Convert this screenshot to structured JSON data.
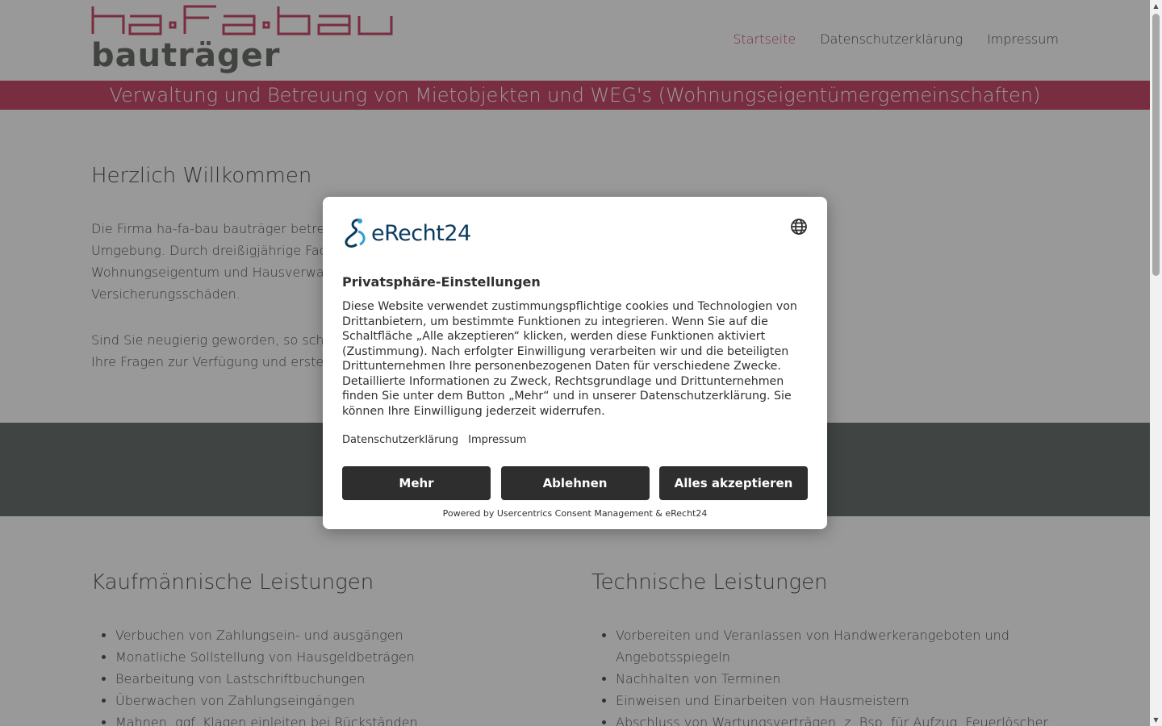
{
  "header": {
    "logo_top_text": "ha-fa-bau",
    "logo_bottom_text": "bauträger",
    "nav": [
      {
        "label": "Startseite",
        "active": true
      },
      {
        "label": "Datenschutzerklärung",
        "active": false
      },
      {
        "label": "Impressum",
        "active": false
      }
    ]
  },
  "banner": {
    "text": "Verwaltung und Betreuung von Mietobjekten und WEG's (Wohnungseigentümergemeinschaften)"
  },
  "welcome": {
    "title": "Herzlich Willkommen",
    "p1_lines": [
      "Die Firma ha-fa-bau bauträger betreut",
      "Umgebung. Durch dreißigjährige Fachk",
      "Wohnungseigentum und Hausverwalt",
      "Versicherungsschäden."
    ],
    "p2_lines": [
      "Sind Sie neugierig geworden, so scheu",
      "Ihre Fragen zur Verfügung und erstelle"
    ]
  },
  "columns": {
    "left": {
      "title": "Kaufmännische Leistungen",
      "items": [
        "Verbuchen von Zahlungsein- und ausgängen",
        "Monatliche Sollstellung von Hausgeldbeträgen",
        "Bearbeitung von Lastschriftbuchungen",
        "Überwachen von Zahlungseingängen",
        "Mahnen, ggf. Klagen einleiten bei Rückständen"
      ]
    },
    "right": {
      "title": "Technische Leistungen",
      "items": [
        "Vorbereiten und Veranlassen von Handwerkerangeboten und Angebotsspiegeln",
        "Nachhalten von Terminen",
        "Einweisen und Einarbeiten von Hausmeistern",
        "Abschluss von Wartungsverträgen, z. Bsp. für Aufzug, Feuerlöscher,"
      ]
    }
  },
  "consent": {
    "brand": "eRecht24",
    "title": "Privatsphäre-Einstellungen",
    "text": "Diese Website verwendet zustimmungspflichtige cookies und Technologien von Drittanbietern, um bestimmte Funktionen zu integrieren. Wenn Sie auf die Schaltfläche „Alle akzeptieren“ klicken, werden diese Funktionen aktiviert (Zustimmung). Nach erfolgter Einwilligung verarbeiten wir und die beteiligten Drittunternehmen Ihre personenbezogenen Daten für verschiedene Zwecke. Detaillierte Informationen zu Zweck, Rechtsgrundlage und Drittunternehmen finden Sie unter dem Button „Mehr“ und in unserer Datenschutzerklärung. Sie können Ihre Einwilligung jederzeit widerrufen.",
    "links": [
      "Datenschutzerklärung",
      "Impressum"
    ],
    "buttons": {
      "more": "Mehr",
      "decline": "Ablehnen",
      "accept": "Alles akzeptieren"
    },
    "powered": "Powered by Usercentrics Consent Management & eRecht24"
  },
  "colors": {
    "accent": "#c94c6c",
    "grey_band": "#6b7370",
    "button": "#2e2e2e"
  }
}
